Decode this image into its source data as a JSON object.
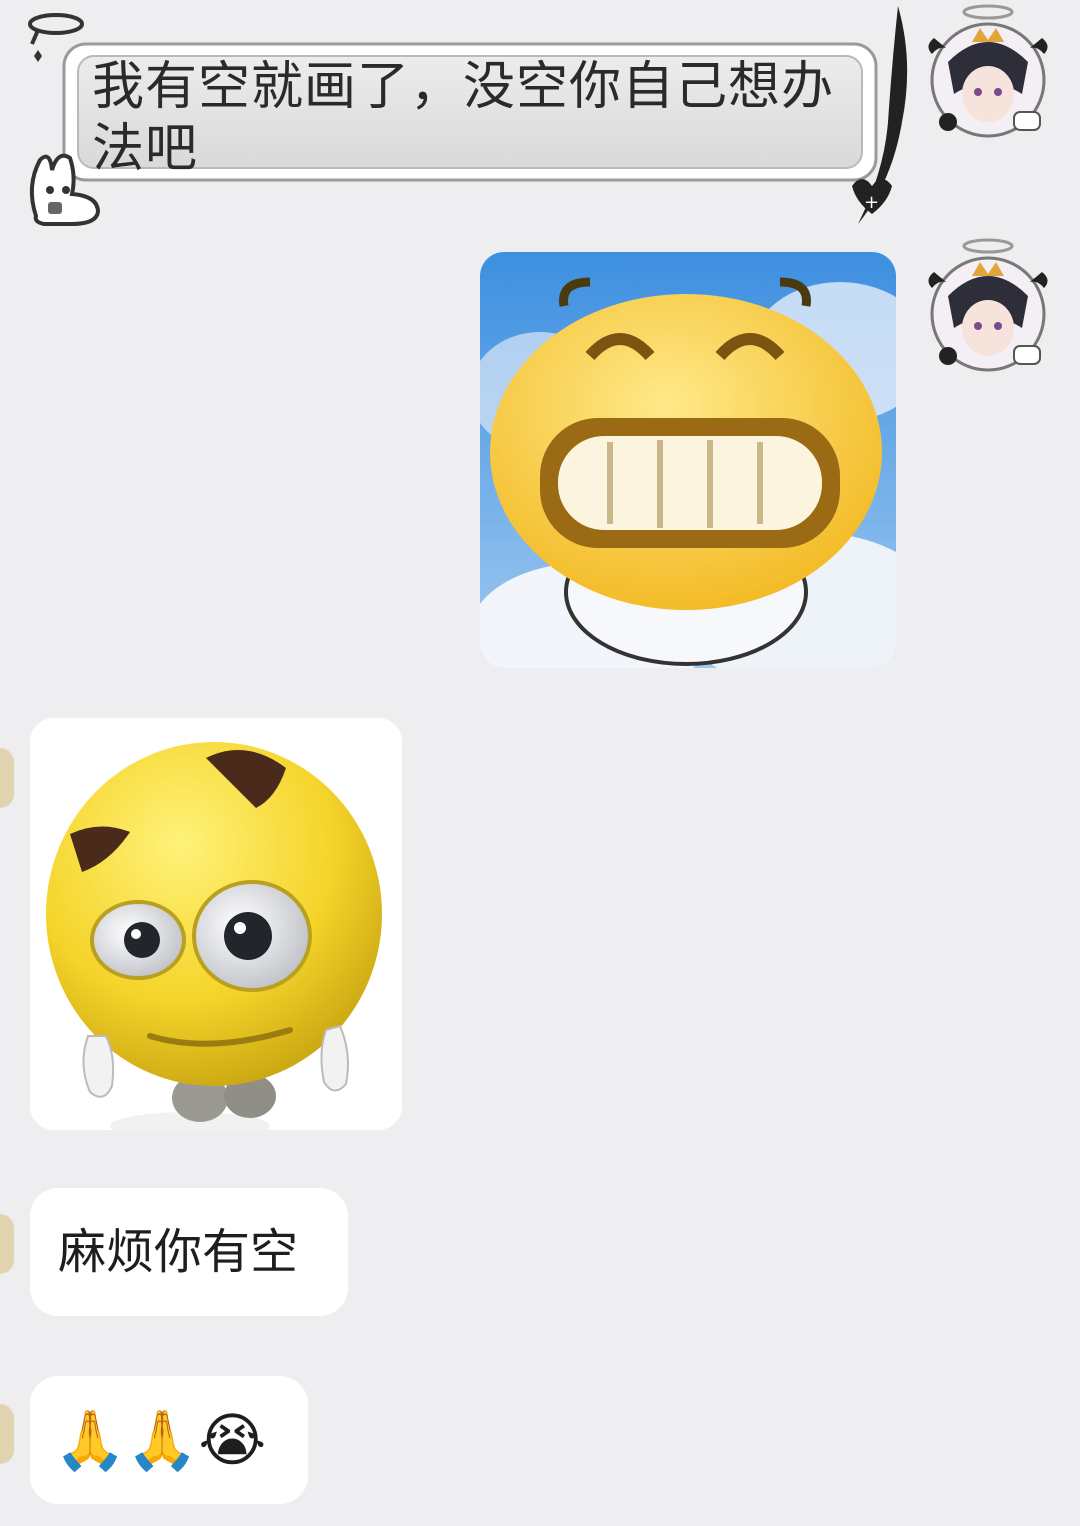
{
  "messages": [
    {
      "side": "right",
      "type": "text-decorated",
      "text": "我有空就画了，没空你自己想办法吧"
    },
    {
      "side": "right",
      "type": "sticker",
      "icon": "grinning-yellow-face-sticker"
    },
    {
      "side": "left",
      "type": "sticker",
      "icon": "smirking-3d-yellow-face-sticker"
    },
    {
      "side": "left",
      "type": "text",
      "text": "麻烦你有空"
    },
    {
      "side": "left",
      "type": "text",
      "text": "🙏🙏😭"
    }
  ],
  "colors": {
    "background": "#eeeef1",
    "bubble": "#ffffff",
    "text": "#1e1e1e",
    "emoji_yellow": "#f5d42a"
  }
}
